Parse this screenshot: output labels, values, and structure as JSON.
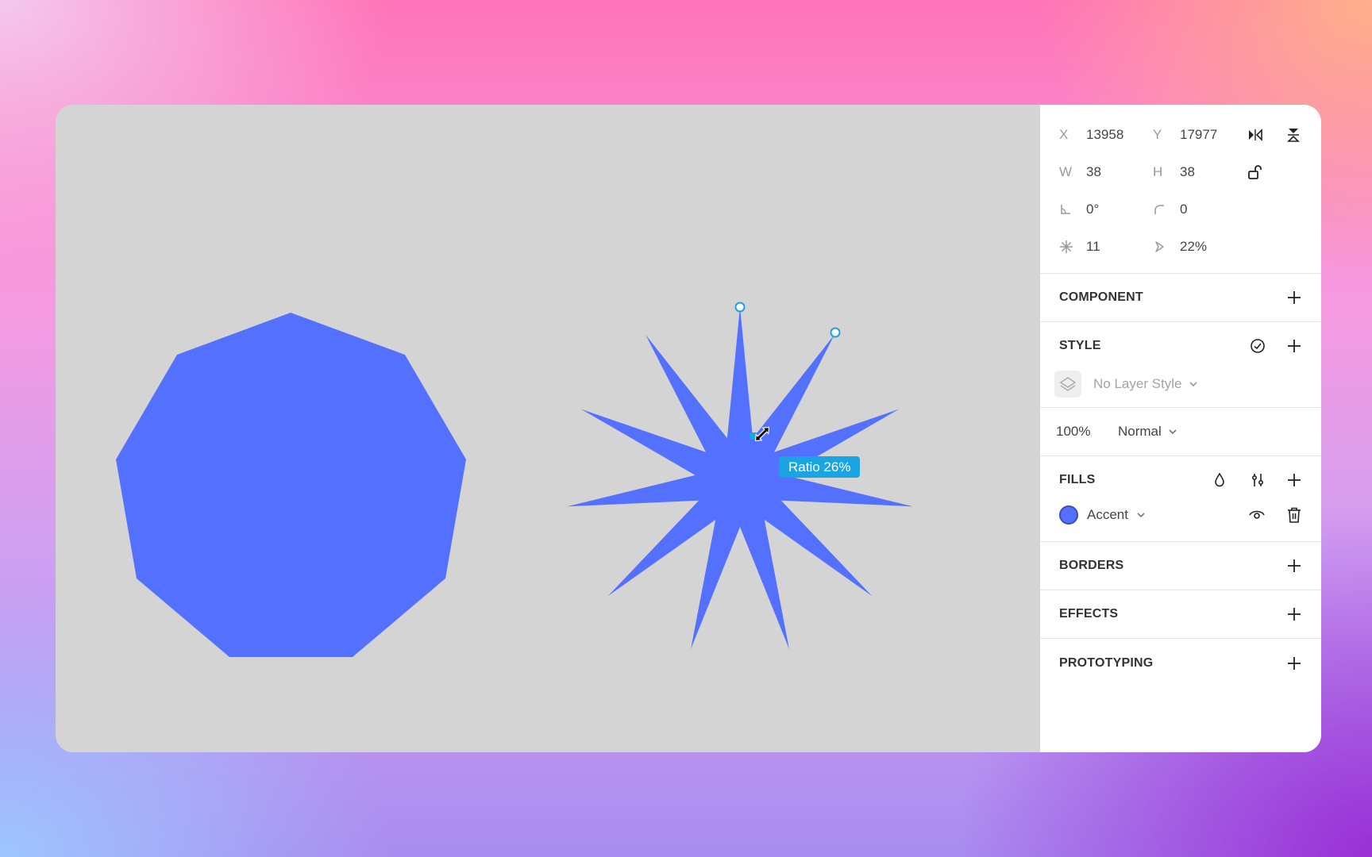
{
  "canvas": {
    "background": "#d4d4d4",
    "shape_color": "#5470ff",
    "ratio_tooltip": "Ratio 26%"
  },
  "panel": {
    "x": {
      "label": "X",
      "value": "13958"
    },
    "y": {
      "label": "Y",
      "value": "17977"
    },
    "w": {
      "label": "W",
      "value": "38"
    },
    "h": {
      "label": "H",
      "value": "38"
    },
    "rotation": {
      "icon": "angle-icon",
      "value": "0°"
    },
    "corner": {
      "icon": "corner-radius-icon",
      "value": "0"
    },
    "points": {
      "icon": "star-points-icon",
      "value": "11"
    },
    "ratio": {
      "icon": "star-ratio-icon",
      "value": "22%"
    },
    "sections": {
      "component": "COMPONENT",
      "style": "STYLE",
      "fills": "FILLS",
      "borders": "BORDERS",
      "effects": "EFFECTS",
      "prototyping": "PROTOTYPING"
    },
    "layer_style": "No Layer Style",
    "opacity": "100%",
    "blend_mode": "Normal",
    "fill": {
      "name": "Accent",
      "color": "#5470ff"
    }
  }
}
